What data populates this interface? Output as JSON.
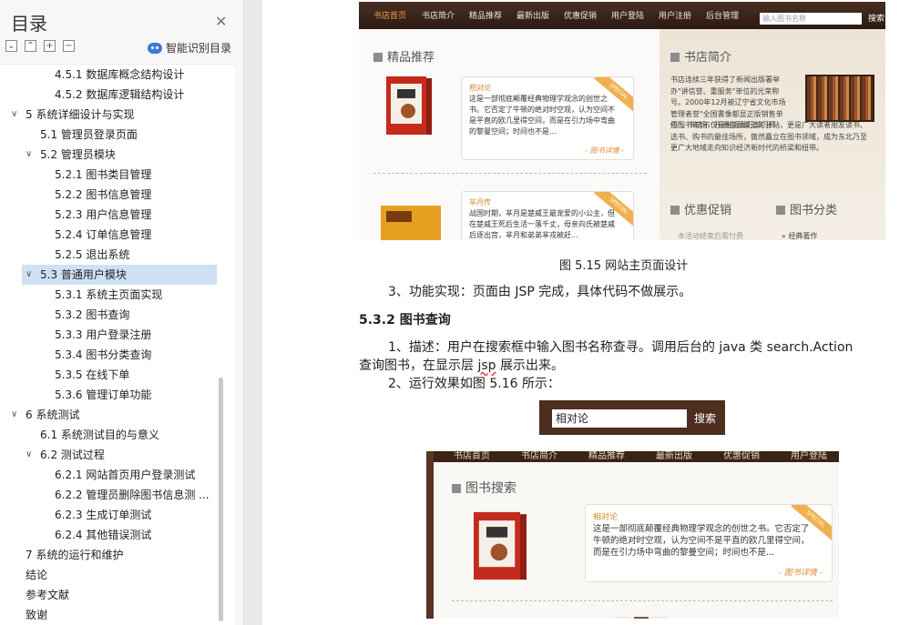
{
  "sidebar": {
    "title": "目录",
    "close_icon": "close-icon",
    "tools": [
      "⌄",
      "⌃",
      "+",
      "−"
    ],
    "smart_label": "智能识别目录",
    "items": [
      {
        "text": "4.5.1  数据库概念结构设计",
        "level": 2
      },
      {
        "text": "4.5.2    数据库逻辑结构设计",
        "level": 2
      },
      {
        "text": "5    系统详细设计与实现",
        "level": 0,
        "caret": "∨"
      },
      {
        "text": "5.1  管理员登录页面",
        "level": 1
      },
      {
        "text": "5.2  管理员模块",
        "level": 1,
        "caret": "∨"
      },
      {
        "text": "5.2.1  图书类目管理",
        "level": 2
      },
      {
        "text": "5.2.2  图书信息管理",
        "level": 2
      },
      {
        "text": "5.2.3  用户信息管理",
        "level": 2
      },
      {
        "text": "5.2.4  订单信息管理",
        "level": 2
      },
      {
        "text": "5.2.5  退出系统",
        "level": 2
      },
      {
        "text": "5.3  普通用户模块",
        "level": 1,
        "caret": "∨",
        "selected": true
      },
      {
        "text": "5.3.1  系统主页面实现",
        "level": 2
      },
      {
        "text": "5.3.2  图书查询",
        "level": 2
      },
      {
        "text": "5.3.3  用户登录注册",
        "level": 2
      },
      {
        "text": "5.3.4  图书分类查询",
        "level": 2
      },
      {
        "text": "5.3.5  在线下单",
        "level": 2
      },
      {
        "text": "5.3.6  管理订单功能",
        "level": 2
      },
      {
        "text": "6    系统测试",
        "level": 0,
        "caret": "∨"
      },
      {
        "text": "6.1  系统测试目的与意义",
        "level": 1
      },
      {
        "text": "6.2  测试过程",
        "level": 1,
        "caret": "∨"
      },
      {
        "text": "6.2.1  网站首页用户登录测试",
        "level": 2
      },
      {
        "text": "6.2.2  管理员删除图书信息测 ...",
        "level": 2
      },
      {
        "text": "6.2.3  生成订单测试",
        "level": 2
      },
      {
        "text": "6.2.4  其他错误测试",
        "level": 2
      },
      {
        "text": "7    系统的运行和维护",
        "level": 0
      },
      {
        "text": "结论",
        "level": 0
      },
      {
        "text": "参考文献",
        "level": 0
      },
      {
        "text": "致谢",
        "level": 0
      }
    ]
  },
  "shot1": {
    "nav": [
      "书店首页",
      "书店简介",
      "精品推荐",
      "最新出版",
      "优惠促销",
      "用户登陆",
      "用户注册",
      "后台管理"
    ],
    "search_placeholder": "输入图书名称",
    "search_button": "搜索",
    "featured_title": "精品推荐",
    "book1_title": "相对论",
    "book1_desc": "这是一部彻底颠覆经典物理学观念的创世之书。它否定了牛顿的绝对时空观，认为空间不是平直的欧几里得空间，而是在引力场中弯曲的黎曼空间；时间也不是...",
    "book1_more": "- 图书详情 -",
    "book2_title": "芈月传",
    "book2_desc": "战国时期，芈月是楚威王最宠爱的小公主，但在楚威王死后生活一落千丈，母亲向氏被楚威后逐出宫，芈月和弟弟芈戎被赶...",
    "ribbon": "SPECIAL",
    "intro_title": "书店简介",
    "intro_text1": "书店连续三年获得了新闻出版署举办\"讲信誉、重服务\"单位的光荣称号。2000年12月被辽宁省文化市场管理者誉\"全国書像都显正版销售单位\"。书店不仅是出版发行部门开",
    "intro_text2": "拓图书市场，开通在源渠道的驿站，更是广大读者朋友读书、选书、购书的最佳场所，傲然矗立在图书领域，成为东北乃至更广大地域走向知识经济新时代的桥梁和纽带。",
    "promo_title": "优惠促销",
    "category_title": "图书分类",
    "promo_item": "本活动结束后需付费",
    "category_item": "» 经典著作"
  },
  "caption1": "图 5.15   网站主页面设计",
  "para1": "3、功能实现：页面由 JSP 完成，具体代码不做展示。",
  "heading": "5.3.2  图书查询",
  "para2a": "1、描述：用户在搜索框中输入图书名称查寻。调用后台的 java 类 search.Action",
  "para2b_pre": "查询图书，在显示层 ",
  "para2b_sq": "jsp",
  "para2b_post": " 展示出来。",
  "para3": "2、运行效果如图 5.16 所示：",
  "search_widget": {
    "value": "相对论",
    "button": "搜索"
  },
  "shot3": {
    "nav": [
      "书店首页",
      "书店简介",
      "精品推荐",
      "最新出版",
      "优惠促销",
      "用户登陆"
    ],
    "section_title": "图书搜索",
    "book_title": "相对论",
    "book_desc": "这是一部彻底颠覆经典物理学观念的创世之书。它否定了牛顿的绝对时空观，认为空间不是平直的欧几里得空间，而是在引力场中弯曲的黎曼空间；时间也不是...",
    "more": "- 图书详情 -",
    "ribbon": "SPECIAL",
    "pager": [
      "<<",
      "1",
      ">>"
    ]
  }
}
